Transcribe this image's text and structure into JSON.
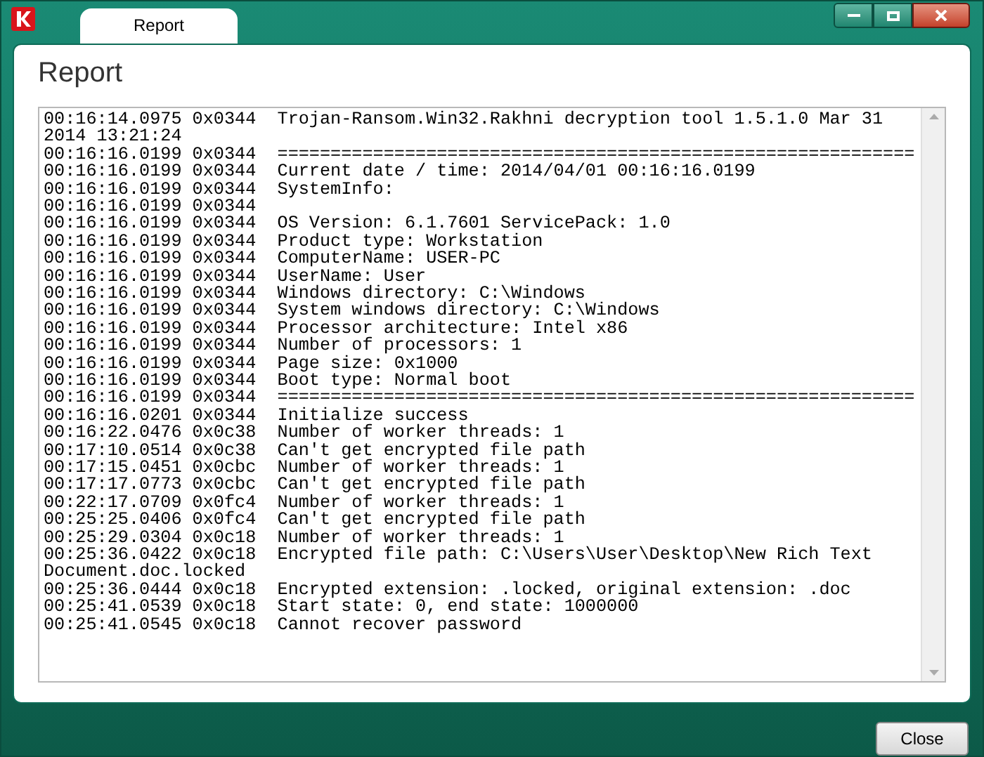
{
  "window": {
    "tab": {
      "label": "Report",
      "selected": true
    }
  },
  "heading": "Report",
  "log_lines": [
    "00:16:14.0975 0x0344  Trojan-Ransom.Win32.Rakhni decryption tool 1.5.1.0 Mar 31 2014 13:21:24",
    "00:16:16.0199 0x0344  ============================================================",
    "00:16:16.0199 0x0344  Current date / time: 2014/04/01 00:16:16.0199",
    "00:16:16.0199 0x0344  SystemInfo:",
    "00:16:16.0199 0x0344",
    "00:16:16.0199 0x0344  OS Version: 6.1.7601 ServicePack: 1.0",
    "00:16:16.0199 0x0344  Product type: Workstation",
    "00:16:16.0199 0x0344  ComputerName: USER-PC",
    "00:16:16.0199 0x0344  UserName: User",
    "00:16:16.0199 0x0344  Windows directory: C:\\Windows",
    "00:16:16.0199 0x0344  System windows directory: C:\\Windows",
    "00:16:16.0199 0x0344  Processor architecture: Intel x86",
    "00:16:16.0199 0x0344  Number of processors: 1",
    "00:16:16.0199 0x0344  Page size: 0x1000",
    "00:16:16.0199 0x0344  Boot type: Normal boot",
    "00:16:16.0199 0x0344  ============================================================",
    "00:16:16.0201 0x0344  Initialize success",
    "00:16:22.0476 0x0c38  Number of worker threads: 1",
    "00:17:10.0514 0x0c38  Can't get encrypted file path",
    "00:17:15.0451 0x0cbc  Number of worker threads: 1",
    "00:17:17.0773 0x0cbc  Can't get encrypted file path",
    "00:22:17.0709 0x0fc4  Number of worker threads: 1",
    "00:25:25.0406 0x0fc4  Can't get encrypted file path",
    "00:25:29.0304 0x0c18  Number of worker threads: 1",
    "00:25:36.0422 0x0c18  Encrypted file path: C:\\Users\\User\\Desktop\\New Rich Text Document.doc.locked",
    "00:25:36.0444 0x0c18  Encrypted extension: .locked, original extension: .doc",
    "00:25:41.0539 0x0c18  Start state: 0, end state: 1000000",
    "00:25:41.0545 0x0c18  Cannot recover password"
  ],
  "buttons": [
    "Close"
  ]
}
